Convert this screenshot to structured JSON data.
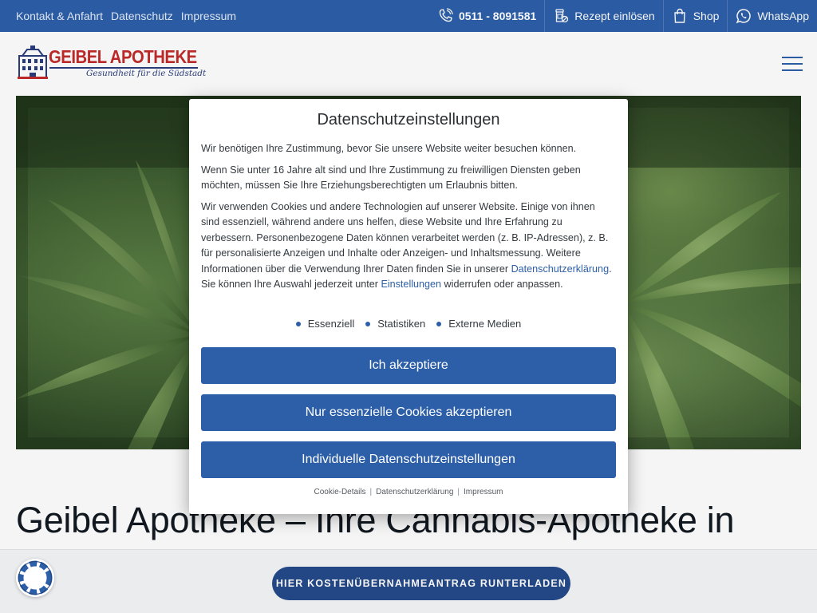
{
  "topbar": {
    "links": [
      "Kontakt & Anfahrt",
      "Datenschutz",
      "Impressum"
    ],
    "phone": "0511 - 8091581",
    "prescription": "Rezept einlösen",
    "shop": "Shop",
    "whatsapp": "WhatsApp"
  },
  "header": {
    "logo_name": "GEIBEL APOTHEKE",
    "logo_claim": "Gesundheit für die Südstadt"
  },
  "main": {
    "headline": "Geibel Apotheke – Ihre Cannabis-Apotheke in"
  },
  "bottombar": {
    "cta": "HIER KOSTENÜBERNAHMEANTRAG RUNTERLADEN"
  },
  "modal": {
    "title": "Datenschutzeinstellungen",
    "p1": "Wir benötigen Ihre Zustimmung, bevor Sie unsere Website weiter besuchen können.",
    "p2": "Wenn Sie unter 16 Jahre alt sind und Ihre Zustimmung zu freiwilligen Diensten geben möchten, müssen Sie Ihre Erziehungsberechtigten um Erlaubnis bitten.",
    "p3_a": "Wir verwenden Cookies und andere Technologien auf unserer Website. Einige von ihnen sind essenziell, während andere uns helfen, diese Website und Ihre Erfahrung zu verbessern. Personenbezogene Daten können verarbeitet werden (z. B. IP-Adressen), z. B. für personalisierte Anzeigen und Inhalte oder Anzeigen- und Inhaltsmessung. Weitere Informationen über die Verwendung Ihrer Daten finden Sie in unserer ",
    "p3_link1": "Datenschutzerklärung",
    "p3_b": ". Sie können Ihre Auswahl jederzeit unter ",
    "p3_link2": "Einstellungen",
    "p3_c": " widerrufen oder anpassen.",
    "categories": [
      "Essenziell",
      "Statistiken",
      "Externe Medien"
    ],
    "buttons": {
      "accept": "Ich akzeptiere",
      "essential": "Nur essenzielle Cookies akzeptieren",
      "individual": "Individuelle Datenschutzeinstellungen"
    },
    "footer_links": [
      "Cookie-Details",
      "Datenschutzerklärung",
      "Impressum"
    ]
  },
  "colors": {
    "brand_blue": "#2d5fa9",
    "logo_red": "#c22a2a",
    "cta_dark_blue": "#254a8a"
  },
  "icons": [
    "phone-icon",
    "prescription-icon",
    "shopping-bag-icon",
    "whatsapp-icon",
    "menu-icon",
    "privacy-icon"
  ]
}
